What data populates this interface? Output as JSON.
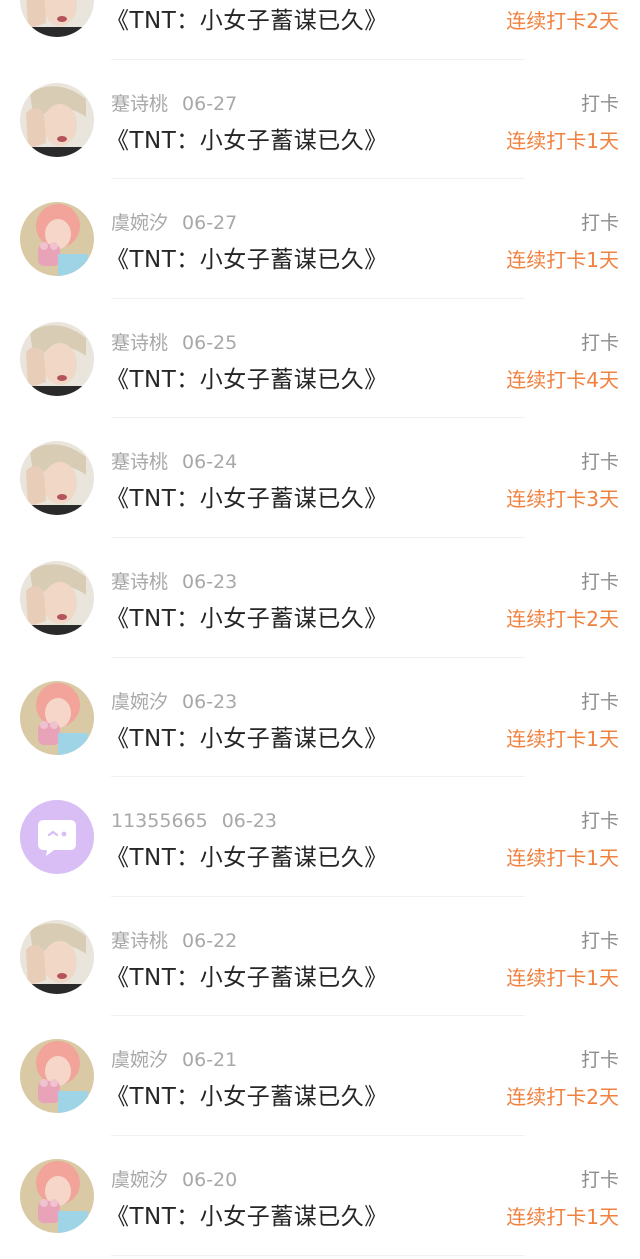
{
  "colors": {
    "title": "#262626",
    "meta": "#a8a8a8",
    "kind": "#8e8e8e",
    "streak": "#f0813f",
    "divider": "#f1f1f1",
    "default_avatar_bg": "#d8bef5"
  },
  "items": [
    {
      "avatar": "blonde-portrait",
      "user": "",
      "date": "",
      "kind": "",
      "title": "《TNT：小女子蓄谋已久》",
      "streak": "连续打卡2天"
    },
    {
      "avatar": "blonde-portrait",
      "user": "蹇诗桃",
      "date": "06-27",
      "kind": "打卡",
      "title": "《TNT：小女子蓄谋已久》",
      "streak": "连续打卡1天"
    },
    {
      "avatar": "pink-hair-portrait",
      "user": "虞婉汐",
      "date": "06-27",
      "kind": "打卡",
      "title": "《TNT：小女子蓄谋已久》",
      "streak": "连续打卡1天"
    },
    {
      "avatar": "blonde-portrait",
      "user": "蹇诗桃",
      "date": "06-25",
      "kind": "打卡",
      "title": "《TNT：小女子蓄谋已久》",
      "streak": "连续打卡4天"
    },
    {
      "avatar": "blonde-portrait",
      "user": "蹇诗桃",
      "date": "06-24",
      "kind": "打卡",
      "title": "《TNT：小女子蓄谋已久》",
      "streak": "连续打卡3天"
    },
    {
      "avatar": "blonde-portrait",
      "user": "蹇诗桃",
      "date": "06-23",
      "kind": "打卡",
      "title": "《TNT：小女子蓄谋已久》",
      "streak": "连续打卡2天"
    },
    {
      "avatar": "pink-hair-portrait",
      "user": "虞婉汐",
      "date": "06-23",
      "kind": "打卡",
      "title": "《TNT：小女子蓄谋已久》",
      "streak": "连续打卡1天"
    },
    {
      "avatar": "default-chat-bubble",
      "user": "11355665",
      "date": "06-23",
      "kind": "打卡",
      "title": "《TNT：小女子蓄谋已久》",
      "streak": "连续打卡1天"
    },
    {
      "avatar": "blonde-portrait",
      "user": "蹇诗桃",
      "date": "06-22",
      "kind": "打卡",
      "title": "《TNT：小女子蓄谋已久》",
      "streak": "连续打卡1天"
    },
    {
      "avatar": "pink-hair-portrait",
      "user": "虞婉汐",
      "date": "06-21",
      "kind": "打卡",
      "title": "《TNT：小女子蓄谋已久》",
      "streak": "连续打卡2天"
    },
    {
      "avatar": "pink-hair-portrait",
      "user": "虞婉汐",
      "date": "06-20",
      "kind": "打卡",
      "title": "《TNT：小女子蓄谋已久》",
      "streak": "连续打卡1天"
    }
  ]
}
